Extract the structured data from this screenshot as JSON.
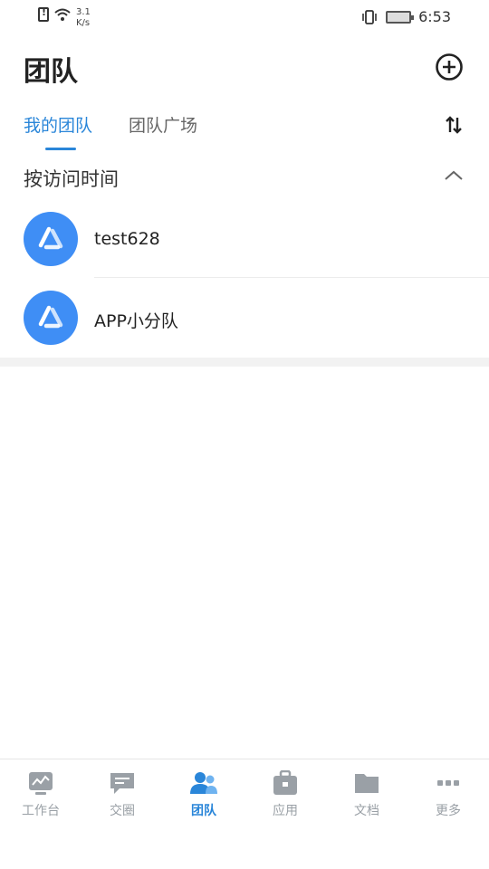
{
  "status_bar": {
    "net_speed_value": "3.1",
    "net_speed_unit": "K/s",
    "time": "6:53"
  },
  "header": {
    "title": "团队",
    "add_icon": "plus-circle-icon"
  },
  "tabs": [
    {
      "label": "我的团队",
      "active": true
    },
    {
      "label": "团队广场",
      "active": false
    }
  ],
  "sort_icon": "sort-arrows-icon",
  "section": {
    "title": "按访问时间",
    "collapse_icon": "chevron-up-icon",
    "teams": [
      {
        "name": "test628",
        "avatar_icon": "team-logo-icon"
      },
      {
        "name": "APP小分队",
        "avatar_icon": "team-logo-icon"
      }
    ]
  },
  "bottom_nav": {
    "items": [
      {
        "label": "工作台",
        "icon": "dashboard-icon",
        "active": false
      },
      {
        "label": "交圈",
        "icon": "chat-icon",
        "active": false
      },
      {
        "label": "团队",
        "icon": "team-icon",
        "active": true
      },
      {
        "label": "应用",
        "icon": "apps-icon",
        "active": false
      },
      {
        "label": "文档",
        "icon": "folder-icon",
        "active": false
      },
      {
        "label": "更多",
        "icon": "more-icon",
        "active": false
      }
    ]
  },
  "colors": {
    "accent": "#2a86d9",
    "avatar": "#3f8ef5",
    "inactive": "#9aa0a6"
  }
}
